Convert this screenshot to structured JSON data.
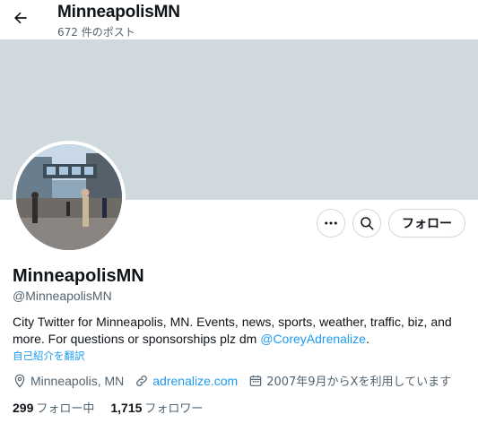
{
  "header": {
    "title": "MinneapolisMN",
    "post_count": "672 件のポスト"
  },
  "colors": {
    "banner": "#cfd9de",
    "link": "#1d9bf0",
    "muted": "#536471"
  },
  "actions": {
    "more_icon": "more-dots-icon",
    "search_icon": "search-icon",
    "follow_label": "フォロー"
  },
  "profile": {
    "name": "MinneapolisMN",
    "handle": "@MinneapolisMN",
    "bio_text": "City Twitter for Minneapolis, MN. Events, news, sports, weather, traffic, biz, and more. For questions or sponsorships plz dm ",
    "bio_mention": "@CoreyAdrenalize",
    "bio_end": ".",
    "translate_label": "自己紹介を翻訳",
    "location": "Minneapolis, MN",
    "website": "adrenalize.com",
    "joined": "2007年9月からXを利用しています"
  },
  "stats": {
    "following_count": "299",
    "following_label": "フォロー中",
    "followers_count": "1,715",
    "followers_label": "フォロワー"
  }
}
